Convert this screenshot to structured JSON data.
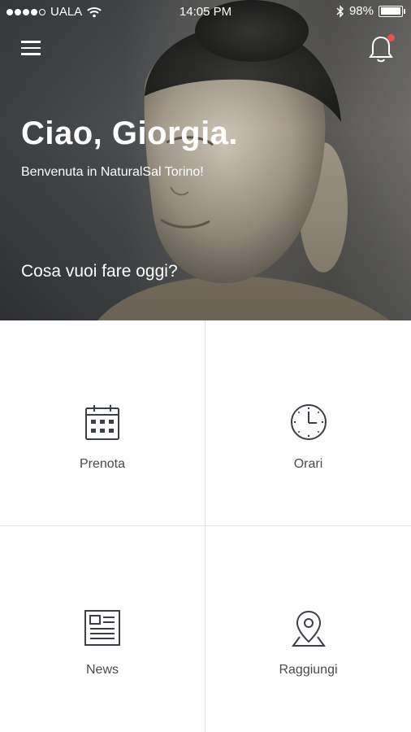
{
  "status_bar": {
    "carrier": "UALA",
    "time": "14:05 PM",
    "battery": "98%",
    "battery_level": 0.98,
    "signal_bars_filled": 4
  },
  "header": {
    "menu_icon": "hamburger-menu-icon",
    "notification_icon": "bell-icon",
    "has_unread_notification": true,
    "greeting": "Ciao, Giorgia.",
    "welcome": "Benvenuta in NaturalSal Torino!",
    "question": "Cosa vuoi fare oggi?"
  },
  "tiles": [
    {
      "label": "Prenota",
      "icon": "calendar-icon"
    },
    {
      "label": "Orari",
      "icon": "clock-icon"
    },
    {
      "label": "News",
      "icon": "newspaper-icon"
    },
    {
      "label": "Raggiungi",
      "icon": "map-pin-icon"
    }
  ],
  "colors": {
    "notification_dot": "#e8554e",
    "tile_text": "#4a4a4a",
    "icon_stroke": "#3b3f46"
  }
}
